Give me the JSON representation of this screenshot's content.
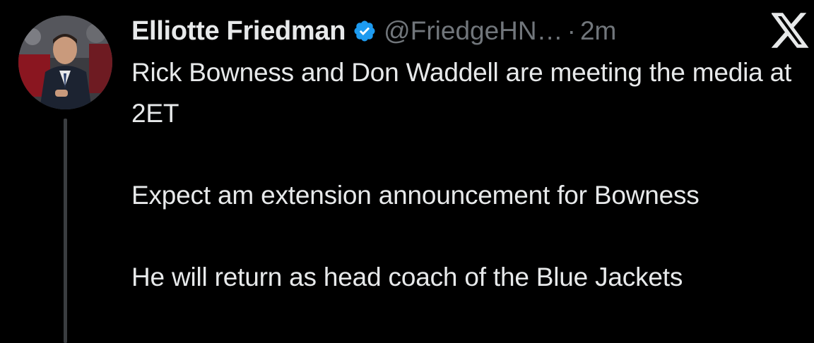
{
  "author": {
    "display_name": "Elliotte Friedman",
    "handle": "@FriedgeHN…",
    "separator": "·",
    "time": "2m",
    "verified": true,
    "verified_color": "#1d9bf0"
  },
  "platform": {
    "logo_icon": "x-logo-icon"
  },
  "tweet": {
    "paragraphs": [
      "Rick Bowness and Don Waddell are meeting the media at 2ET",
      "Expect am extension announcement for Bowness",
      "He will return as head coach of the Blue Jackets"
    ]
  },
  "colors": {
    "background": "#000000",
    "text": "#e7e9ea",
    "secondary_text": "#71767b",
    "thread_line": "#3a3d40"
  }
}
